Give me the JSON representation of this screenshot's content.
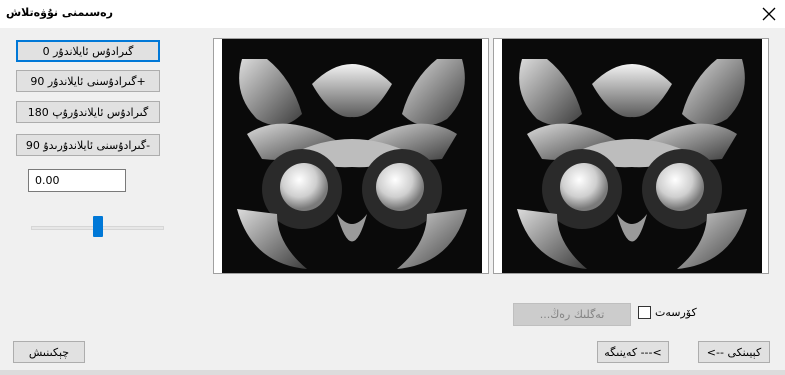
{
  "window": {
    "title": "رەسىمنى نۇۋەتلاش",
    "close_icon": "close-icon"
  },
  "rotate_buttons": [
    {
      "label": "گىرادۇس ئايلاندۇر 0"
    },
    {
      "label": "گىرادۇسنى ئايلاندۇر 90+"
    },
    {
      "label": "گىرادۇس ئايلاندۇرۇپ 180"
    },
    {
      "label": "گىرادۇسنى ئايلاندۇرىدۇ 90-"
    }
  ],
  "angle_input": {
    "value": "0.00"
  },
  "slider": {
    "value_fraction": 0.5
  },
  "previews": {
    "left": "original-image",
    "right": "rotated-image"
  },
  "apply_button": {
    "label": "...تەگلىك رەڭ"
  },
  "show_checkbox": {
    "label": "كۆرسەت",
    "checked": false
  },
  "footer": {
    "cancel_label": "چېكىنىش",
    "prev_label": "كەينىگە ---<",
    "next_label": "<-- كېيىنكى"
  }
}
